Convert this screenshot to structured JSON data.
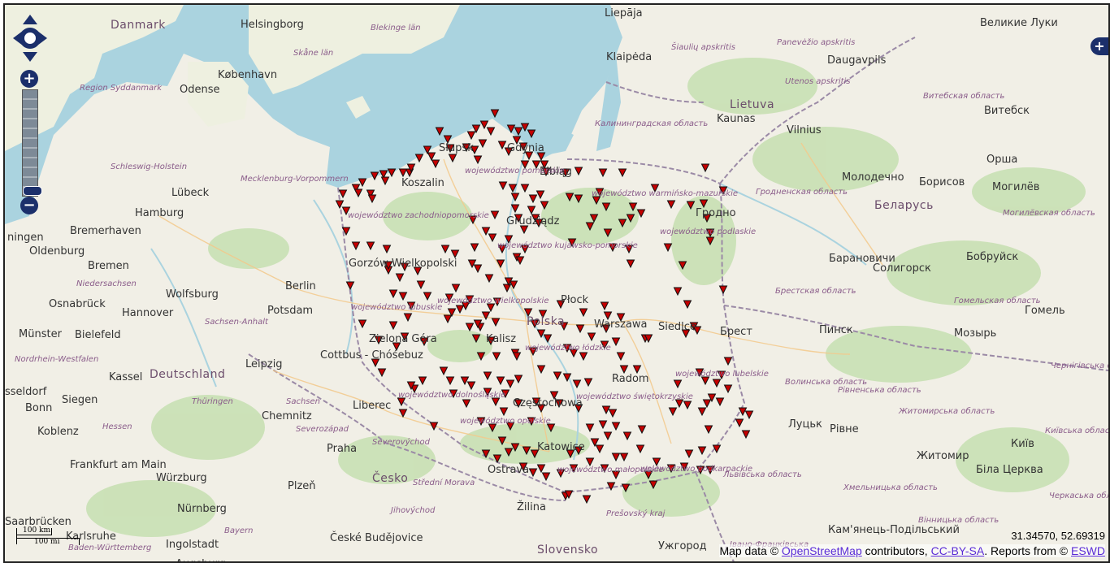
{
  "map": {
    "controls": {
      "zoom_in": "+",
      "zoom_out": "−",
      "layer_switcher": "+"
    },
    "scale": {
      "km": "100 km",
      "mi": "100 mi"
    },
    "cursor_coords": "31.34570, 52.69319",
    "attribution": {
      "prefix": "Map data ©",
      "osm": "OpenStreetMap",
      "mid": "contributors,",
      "license": "CC-BY-SA",
      "reports": ". Reports from ©",
      "eswd": "ESWD"
    },
    "colors": {
      "sea": "#aad3df",
      "land": "#eef0e0",
      "forest": "#c6dfb0",
      "marker": "#c40000",
      "border": "#9b8aa6"
    },
    "labels": [
      {
        "t": "Danmark",
        "k": "country"
      },
      {
        "t": "Helsingborg",
        "k": "city"
      },
      {
        "t": "Blekinge län",
        "k": "region"
      },
      {
        "t": "Liepāja",
        "k": "city"
      },
      {
        "t": "Великие Луки",
        "k": "city"
      },
      {
        "t": "Skåne län",
        "k": "region"
      },
      {
        "t": "København",
        "k": "city"
      },
      {
        "t": "Odense",
        "k": "city"
      },
      {
        "t": "Region Syddanmark",
        "k": "region"
      },
      {
        "t": "Klaipėda",
        "k": "city"
      },
      {
        "t": "Šiaulių apskritis",
        "k": "region"
      },
      {
        "t": "Panevėžio apskritis",
        "k": "region"
      },
      {
        "t": "Daugavpils",
        "k": "city"
      },
      {
        "t": "Utenos apskritis",
        "k": "region"
      },
      {
        "t": "Lietuva",
        "k": "country"
      },
      {
        "t": "Витебская область",
        "k": "region"
      },
      {
        "t": "Витебск",
        "k": "city"
      },
      {
        "t": "Kaunas",
        "k": "city"
      },
      {
        "t": "Vilnius",
        "k": "city"
      },
      {
        "t": "Калининградская область",
        "k": "region"
      },
      {
        "t": "Орша",
        "k": "city"
      },
      {
        "t": "Schleswig-Holstein",
        "k": "region"
      },
      {
        "t": "Słupsk",
        "k": "city"
      },
      {
        "t": "Gdynia",
        "k": "city"
      },
      {
        "t": "Elbląg",
        "k": "city"
      },
      {
        "t": "Koszalin",
        "k": "city"
      },
      {
        "t": "Mecklenburg-Vorpommern",
        "k": "region"
      },
      {
        "t": "Lübeck",
        "k": "city"
      },
      {
        "t": "Hamburg",
        "k": "city"
      },
      {
        "t": "województwo pomorskie",
        "k": "region"
      },
      {
        "t": "Молодечно",
        "k": "city"
      },
      {
        "t": "Борисов",
        "k": "city"
      },
      {
        "t": "Могилёв",
        "k": "city"
      },
      {
        "t": "Гродненская область",
        "k": "region"
      },
      {
        "t": "Беларусь",
        "k": "country"
      },
      {
        "t": "Могилёвская область",
        "k": "region"
      },
      {
        "t": "Гродно",
        "k": "city"
      },
      {
        "t": "województwo warmińsko-mazurskie",
        "k": "region"
      },
      {
        "t": "Bremerhaven",
        "k": "city"
      },
      {
        "t": "Oldenburg",
        "k": "city"
      },
      {
        "t": "ningen",
        "k": "city"
      },
      {
        "t": "województwo zachodniopomorskie",
        "k": "region"
      },
      {
        "t": "Grudziądz",
        "k": "city"
      },
      {
        "t": "Bremen",
        "k": "city"
      },
      {
        "t": "Gorzów Wielkopolski",
        "k": "city"
      },
      {
        "t": "województwo kujawsko-pomorskie",
        "k": "region"
      },
      {
        "t": "województwo podlaskie",
        "k": "region"
      },
      {
        "t": "Барановичи",
        "k": "city"
      },
      {
        "t": "Солигорск",
        "k": "city"
      },
      {
        "t": "Бобруйск",
        "k": "city"
      },
      {
        "t": "Niedersachsen",
        "k": "region"
      },
      {
        "t": "Berlin",
        "k": "city"
      },
      {
        "t": "Wolfsburg",
        "k": "city"
      },
      {
        "t": "Osnabrück",
        "k": "city"
      },
      {
        "t": "Hannover",
        "k": "city"
      },
      {
        "t": "Potsdam",
        "k": "city"
      },
      {
        "t": "województwo lubuskie",
        "k": "region"
      },
      {
        "t": "województwo wielkopolskie",
        "k": "region"
      },
      {
        "t": "Płock",
        "k": "city"
      },
      {
        "t": "Warszawa",
        "k": "city"
      },
      {
        "t": "Siedlce",
        "k": "city"
      },
      {
        "t": "Брестская область",
        "k": "region"
      },
      {
        "t": "Гомельская область",
        "k": "region"
      },
      {
        "t": "Гомель",
        "k": "city"
      },
      {
        "t": "Münster",
        "k": "city"
      },
      {
        "t": "Bielefeld",
        "k": "city"
      },
      {
        "t": "Sachsen-Anhalt",
        "k": "region"
      },
      {
        "t": "Polska",
        "k": "country"
      },
      {
        "t": "Kalisz",
        "k": "city"
      },
      {
        "t": "Zielona Góra",
        "k": "city"
      },
      {
        "t": "Брест",
        "k": "city"
      },
      {
        "t": "Пинск",
        "k": "city"
      },
      {
        "t": "Мозырь",
        "k": "city"
      },
      {
        "t": "Nordrhein-Westfalen",
        "k": "region"
      },
      {
        "t": "Cottbus - Chóśebuz",
        "k": "city"
      },
      {
        "t": "Leipzig",
        "k": "city"
      },
      {
        "t": "województwo łódzkie",
        "k": "region"
      },
      {
        "t": "Kassel",
        "k": "city"
      },
      {
        "t": "Deutschland",
        "k": "country"
      },
      {
        "t": "Radom",
        "k": "city"
      },
      {
        "t": "województwo lubelskie",
        "k": "region"
      },
      {
        "t": "Волинська область",
        "k": "region"
      },
      {
        "t": "Рівненська область",
        "k": "region"
      },
      {
        "t": "Чернігівська область",
        "k": "region"
      },
      {
        "t": "sseldorf",
        "k": "city"
      },
      {
        "t": "Siegen",
        "k": "city"
      },
      {
        "t": "Thüringen",
        "k": "region"
      },
      {
        "t": "Sachsen",
        "k": "region"
      },
      {
        "t": "Liberec",
        "k": "city"
      },
      {
        "t": "województwo dolnośląskie",
        "k": "region"
      },
      {
        "t": "Częstochowa",
        "k": "city"
      },
      {
        "t": "województwo świętokrzyskie",
        "k": "region"
      },
      {
        "t": "Bonn",
        "k": "city"
      },
      {
        "t": "Chemnitz",
        "k": "city"
      },
      {
        "t": "Koblenz",
        "k": "city"
      },
      {
        "t": "Hessen",
        "k": "region"
      },
      {
        "t": "Severozápad",
        "k": "region"
      },
      {
        "t": "województwo opolskie",
        "k": "region"
      },
      {
        "t": "Луцьк",
        "k": "city"
      },
      {
        "t": "Рівне",
        "k": "city"
      },
      {
        "t": "Житомирська область",
        "k": "region"
      },
      {
        "t": "Київ",
        "k": "city"
      },
      {
        "t": "Київська область",
        "k": "region"
      },
      {
        "t": "Praha",
        "k": "city"
      },
      {
        "t": "Severovýchod",
        "k": "region"
      },
      {
        "t": "Katowice",
        "k": "city"
      },
      {
        "t": "Житомир",
        "k": "city"
      },
      {
        "t": "Frankfurt am Main",
        "k": "city"
      },
      {
        "t": "Würzburg",
        "k": "city"
      },
      {
        "t": "Česko",
        "k": "country"
      },
      {
        "t": "Ostrava",
        "k": "city"
      },
      {
        "t": "województwo małopolskie",
        "k": "region"
      },
      {
        "t": "województwo podkarpackie",
        "k": "region"
      },
      {
        "t": "Львівська область",
        "k": "region"
      },
      {
        "t": "Біла Церква",
        "k": "city"
      },
      {
        "t": "Plzeň",
        "k": "city"
      },
      {
        "t": "Střední Morava",
        "k": "region"
      },
      {
        "t": "Хмельницька область",
        "k": "region"
      },
      {
        "t": "Черкаська область",
        "k": "region"
      },
      {
        "t": "Nürnberg",
        "k": "city"
      },
      {
        "t": "Jihovýchod",
        "k": "region"
      },
      {
        "t": "Žilina",
        "k": "city"
      },
      {
        "t": "Prešovský kraj",
        "k": "region"
      },
      {
        "t": "Вінницька область",
        "k": "region"
      },
      {
        "t": "Saarbrücken",
        "k": "city"
      },
      {
        "t": "Karlsruhe",
        "k": "city"
      },
      {
        "t": "Bayern",
        "k": "region"
      },
      {
        "t": "Кам'янець-Подільський",
        "k": "city"
      },
      {
        "t": "Baden-Württemberg",
        "k": "region"
      },
      {
        "t": "Ingolstadt",
        "k": "city"
      },
      {
        "t": "České Budějovice",
        "k": "city"
      },
      {
        "t": "Slovensko",
        "k": "country"
      },
      {
        "t": "Ужгород",
        "k": "city"
      },
      {
        "t": "Івано-Франківська",
        "k": "region"
      },
      {
        "t": "Augsburg",
        "k": "city"
      }
    ],
    "marker_name": "storm-report-marker"
  }
}
